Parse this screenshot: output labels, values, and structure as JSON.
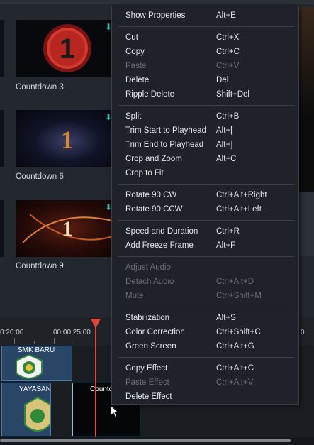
{
  "media": {
    "items": [
      {
        "label": "Countdown 3",
        "thumb_text": "1"
      },
      {
        "label": "Countdown 6",
        "thumb_text": "1"
      },
      {
        "label": "Countdown 9",
        "thumb_text": "1"
      }
    ]
  },
  "timeline": {
    "ruler": [
      "0:20:00",
      "00:00:25:00",
      "0"
    ],
    "clips": [
      {
        "label": "SMK BARU"
      },
      {
        "label": "YAYASAN"
      },
      {
        "label": "Countd"
      }
    ]
  },
  "menu": {
    "items": [
      {
        "label": "Show Properties",
        "shortcut": "Alt+E",
        "enabled": true
      },
      {
        "label": "Cut",
        "shortcut": "Ctrl+X",
        "enabled": true
      },
      {
        "label": "Copy",
        "shortcut": "Ctrl+C",
        "enabled": true
      },
      {
        "label": "Paste",
        "shortcut": "Ctrl+V",
        "enabled": false
      },
      {
        "label": "Delete",
        "shortcut": "Del",
        "enabled": true
      },
      {
        "label": "Ripple Delete",
        "shortcut": "Shift+Del",
        "enabled": true
      },
      {
        "label": "Split",
        "shortcut": "Ctrl+B",
        "enabled": true
      },
      {
        "label": "Trim Start to Playhead",
        "shortcut": "Alt+[",
        "enabled": true
      },
      {
        "label": "Trim End to Playhead",
        "shortcut": "Alt+]",
        "enabled": true
      },
      {
        "label": "Crop and Zoom",
        "shortcut": "Alt+C",
        "enabled": true
      },
      {
        "label": "Crop to Fit",
        "shortcut": "",
        "enabled": true
      },
      {
        "label": "Rotate 90 CW",
        "shortcut": "Ctrl+Alt+Right",
        "enabled": true
      },
      {
        "label": "Rotate 90 CCW",
        "shortcut": "Ctrl+Alt+Left",
        "enabled": true
      },
      {
        "label": "Speed and Duration",
        "shortcut": "Ctrl+R",
        "enabled": true
      },
      {
        "label": "Add Freeze Frame",
        "shortcut": "Alt+F",
        "enabled": true
      },
      {
        "label": "Adjust Audio",
        "shortcut": "",
        "enabled": false
      },
      {
        "label": "Detach Audio",
        "shortcut": "Ctrl+Alt+D",
        "enabled": false
      },
      {
        "label": "Mute",
        "shortcut": "Ctrl+Shift+M",
        "enabled": false
      },
      {
        "label": "Stabilization",
        "shortcut": "Alt+S",
        "enabled": true
      },
      {
        "label": "Color Correction",
        "shortcut": "Ctrl+Shift+C",
        "enabled": true
      },
      {
        "label": "Green Screen",
        "shortcut": "Ctrl+Alt+G",
        "enabled": true
      },
      {
        "label": "Copy Effect",
        "shortcut": "Ctrl+Alt+C",
        "enabled": true
      },
      {
        "label": "Paste Effect",
        "shortcut": "Ctrl+Alt+V",
        "enabled": false
      },
      {
        "label": "Delete Effect",
        "shortcut": "",
        "enabled": true
      }
    ]
  },
  "colors": {
    "accent": "#36c9b8",
    "playhead": "#e0463e",
    "clip": "#2a4666",
    "menu_bg": "#1f2329"
  }
}
